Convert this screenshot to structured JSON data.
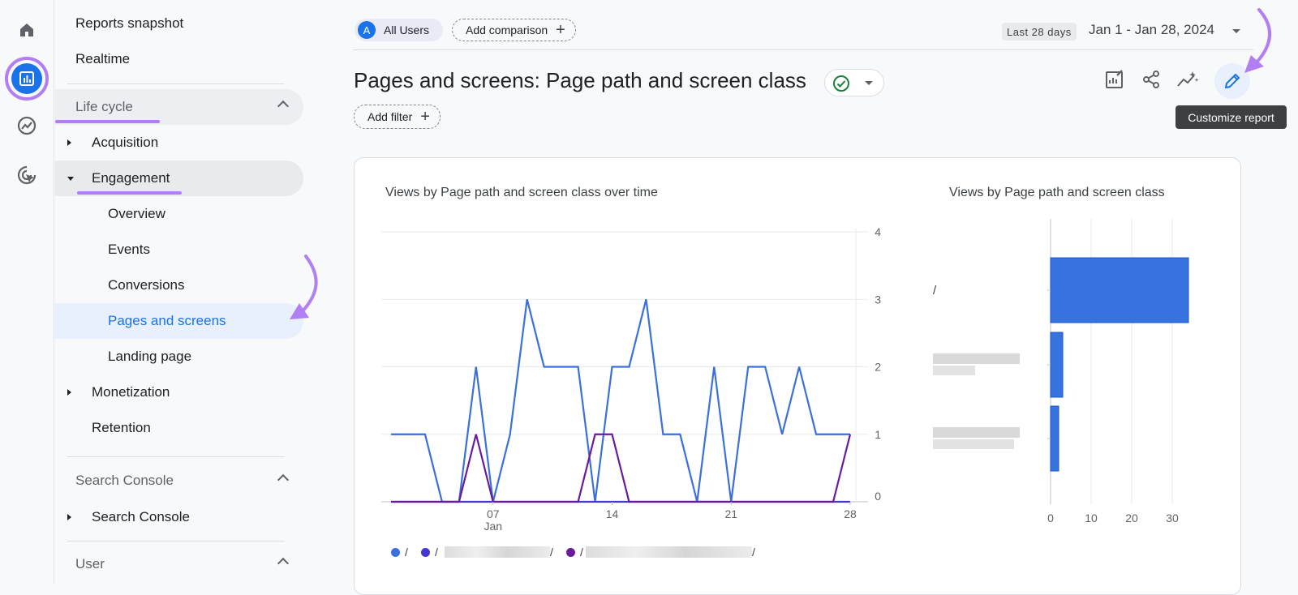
{
  "rail": {
    "icons": [
      "home-icon",
      "reports-icon",
      "explore-icon",
      "advertising-icon"
    ]
  },
  "sidebar": {
    "reports_snapshot": "Reports snapshot",
    "realtime": "Realtime",
    "lifecycle": "Life cycle",
    "acquisition": "Acquisition",
    "engagement": "Engagement",
    "engagement_items": [
      "Overview",
      "Events",
      "Conversions",
      "Pages and screens",
      "Landing page"
    ],
    "monetization": "Monetization",
    "retention": "Retention",
    "search_console_section": "Search Console",
    "search_console": "Search Console",
    "user_section": "User"
  },
  "topbar": {
    "segment_avatar": "A",
    "segment": "All Users",
    "add_comparison": "Add comparison",
    "date_badge": "Last 28 days",
    "date_range": "Jan 1 - Jan 28, 2024"
  },
  "header": {
    "title": "Pages and screens: Page path and screen class",
    "add_filter": "Add filter",
    "tooltip": "Customize report"
  },
  "colors": {
    "accent": "#1a73e8",
    "annotation": "#b17ef3",
    "series1": "#3a6fdc",
    "series2": "#4437d1",
    "series3": "#6a1b9a",
    "selected_bg": "#e8f0fe"
  },
  "chart_data": [
    {
      "type": "line",
      "title": "Views by Page path and screen class over time",
      "x": [
        1,
        2,
        3,
        4,
        5,
        6,
        7,
        8,
        9,
        10,
        11,
        12,
        13,
        14,
        15,
        16,
        17,
        18,
        19,
        20,
        21,
        22,
        23,
        24,
        25,
        26,
        27,
        28
      ],
      "x_tick_labels": [
        [
          "07",
          "Jan"
        ],
        [
          "14"
        ],
        [
          "21"
        ],
        [
          "28"
        ]
      ],
      "x_tick_positions": [
        7,
        14,
        21,
        28
      ],
      "ylim": [
        0,
        4
      ],
      "y_ticks": [
        "0",
        "1",
        "2",
        "3",
        "4"
      ],
      "series": [
        {
          "name": "/",
          "values": [
            1,
            1,
            1,
            0,
            0,
            2,
            0,
            1,
            3,
            2,
            2,
            2,
            0,
            2,
            2,
            3,
            1,
            1,
            0,
            2,
            0,
            2,
            2,
            1,
            2,
            1,
            1,
            1
          ]
        },
        {
          "name": "/",
          "values": [
            0,
            0,
            0,
            0,
            0,
            0,
            0,
            0,
            0,
            0,
            0,
            0,
            0,
            0,
            0,
            0,
            0,
            0,
            0,
            0,
            0,
            0,
            0,
            0,
            0,
            0,
            0,
            0
          ]
        },
        {
          "name": "/",
          "values": [
            0,
            0,
            0,
            0,
            0,
            1,
            0,
            0,
            0,
            0,
            0,
            0,
            1,
            1,
            0,
            0,
            0,
            0,
            0,
            0,
            0,
            0,
            0,
            0,
            0,
            0,
            0,
            1
          ]
        }
      ],
      "legend": [
        "/",
        "/",
        "/"
      ]
    },
    {
      "type": "bar",
      "orientation": "horizontal",
      "title": "Views by Page path and screen class",
      "categories": [
        "/",
        "",
        ""
      ],
      "values": [
        34,
        3,
        2
      ],
      "xlim": [
        0,
        36
      ],
      "x_ticks": [
        "0",
        "10",
        "20",
        "30"
      ]
    }
  ]
}
